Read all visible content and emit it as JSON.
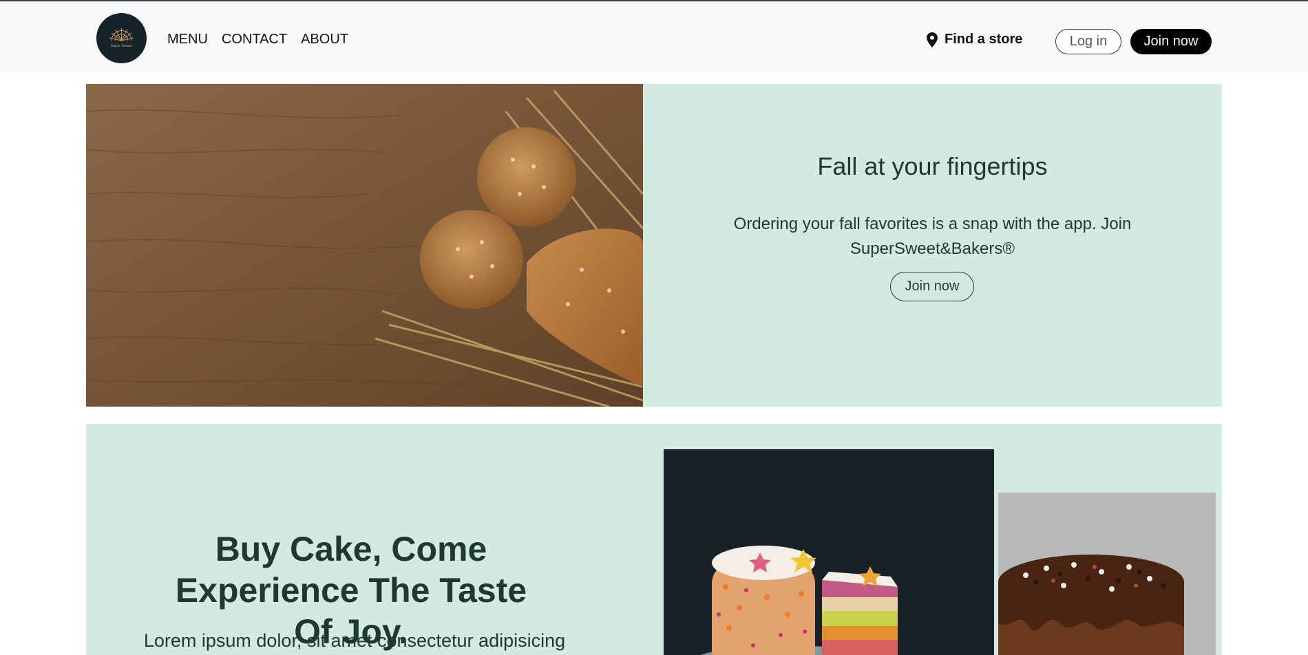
{
  "header": {
    "logo_text": "Super Sweet",
    "nav": [
      "MENU",
      "CONTACT",
      "ABOUT"
    ],
    "find_store": "Find a store",
    "login": "Log in",
    "join": "Join now"
  },
  "hero": {
    "title": "Fall at your fingertips",
    "text": "Ordering your fall favorites is a snap with the app. Join SuperSweet&Bakers®",
    "join": "Join now"
  },
  "promo": {
    "title": "Buy Cake, Come Experience The Taste Of Joy.",
    "text": "Lorem ipsum dolor, sit amet consectetur adipisicing"
  },
  "colors": {
    "mint": "#d4e9e2",
    "dark_green": "#1e3932",
    "logo_bg": "#17232a"
  },
  "icons": {
    "logo": "sunburst-logo",
    "find_store": "location-pin-icon"
  }
}
